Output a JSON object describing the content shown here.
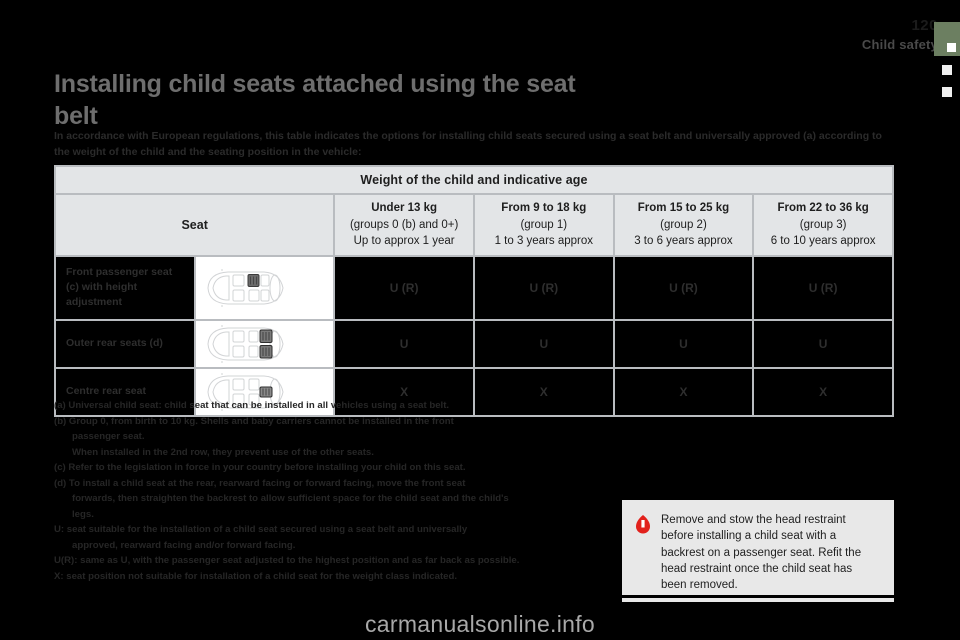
{
  "header": {
    "page_number": "120",
    "section": "Child safety",
    "accent_color": "#6c7f61"
  },
  "title": "Installing child seats attached using the seat belt",
  "intro": "In accordance with European regulations, this table indicates the options for installing child seats secured using a seat belt and universally approved (a) according to the weight of the child and the seating position in the vehicle:",
  "table": {
    "top_header": "Weight of the child and indicative age",
    "seat_header": "Seat",
    "groups": [
      {
        "weight": "Under 13 kg",
        "group": "(groups 0 (b) and 0+)",
        "age": "Up to approx 1 year"
      },
      {
        "weight": "From 9 to 18 kg",
        "group": "(group 1)",
        "age": "1 to 3 years approx"
      },
      {
        "weight": "From 15 to 25 kg",
        "group": "(group 2)",
        "age": "3 to 6 years approx"
      },
      {
        "weight": "From 22 to 36 kg",
        "group": "(group 3)",
        "age": "6 to 10 years approx"
      }
    ],
    "rows": [
      {
        "label": "Front passenger seat (c) with height adjustment",
        "diagram": "car-front-passenger-seat",
        "values": [
          "U (R)",
          "U (R)",
          "U (R)",
          "U (R)"
        ]
      },
      {
        "label": "Outer rear seats (d)",
        "diagram": "car-outer-rear-seats",
        "values": [
          "U",
          "U",
          "U",
          "U"
        ]
      },
      {
        "label": "Centre rear seat",
        "diagram": "car-centre-rear-seat",
        "values": [
          "X",
          "X",
          "X",
          "X"
        ]
      }
    ]
  },
  "notes": {
    "a": "(a) Universal child seat: child seat that can be installed in all vehicles using a seat belt.",
    "b1": "(b) Group 0, from birth to 10 kg. Shells and baby carriers cannot be installed in the front",
    "b2": "passenger seat.",
    "b3": "When installed in the 2nd row, they prevent use of the other seats.",
    "c": "(c) Refer to the legislation in force in your country before installing your child on this seat.",
    "d1": "(d) To install a child seat at the rear, rearward facing or forward facing, move the front seat",
    "d2": "forwards, then straighten the backrest to allow sufficient space for the child seat and the child's",
    "d3": "legs.",
    "u1": "U: seat suitable for the installation of a child seat secured using a seat belt and universally",
    "u2": "approved, rearward facing and/or forward facing.",
    "ur": "U(R): same as U, with the passenger seat adjusted to the highest position and as far back as possible.",
    "x": "X: seat position not suitable for installation of a child seat for the weight class indicated."
  },
  "warning": {
    "icon": "warning-triangle-icon",
    "icon_color": "#e2211c",
    "text": "Remove and stow the head restraint before installing a child seat with a backrest on a passenger seat. Refit the head restraint once the child seat has been removed."
  },
  "watermark": "carmanualsonline.info"
}
